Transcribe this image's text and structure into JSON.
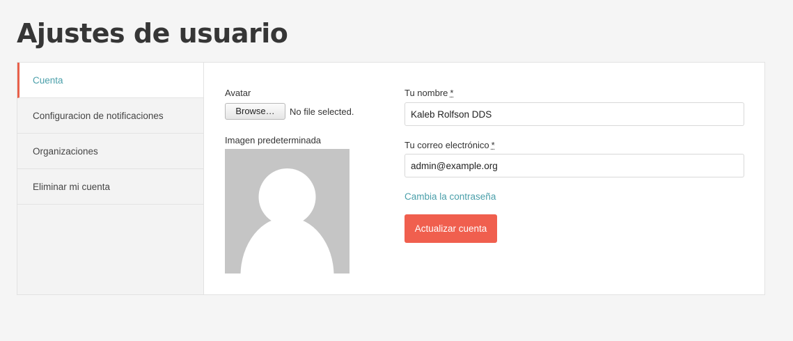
{
  "page": {
    "title": "Ajustes de usuario"
  },
  "sidebar": {
    "items": [
      {
        "label": "Cuenta",
        "active": true
      },
      {
        "label": "Configuracion de notificaciones",
        "active": false
      },
      {
        "label": "Organizaciones",
        "active": false
      },
      {
        "label": "Eliminar mi cuenta",
        "active": false
      }
    ]
  },
  "avatar": {
    "label": "Avatar",
    "browse_label": "Browse…",
    "file_status": "No file selected.",
    "default_label": "Imagen predeterminada"
  },
  "form": {
    "name_label": "Tu nombre",
    "name_value": "Kaleb Rolfson DDS",
    "email_label": "Tu correo electrónico",
    "email_value": "admin@example.org",
    "required_marker": "*",
    "change_password_link": "Cambia la contraseña",
    "submit_label": "Actualizar cuenta"
  },
  "colors": {
    "accent": "#f05f4e",
    "link": "#4a9faa",
    "active_marker": "#e9604a"
  }
}
